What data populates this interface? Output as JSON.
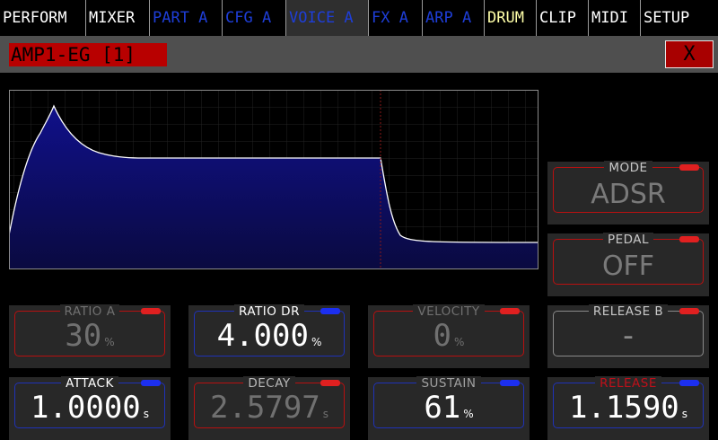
{
  "tabs": [
    {
      "label": "PERFORM",
      "color": "#ffffff"
    },
    {
      "label": "MIXER",
      "color": "#ffffff"
    },
    {
      "label": "PART A",
      "color": "#1e3ed8"
    },
    {
      "label": "CFG A",
      "color": "#1e3ed8"
    },
    {
      "label": "VOICE A",
      "color": "#1e3ed8",
      "active": true
    },
    {
      "label": "FX A",
      "color": "#1e3ed8"
    },
    {
      "label": "ARP A",
      "color": "#1e3ed8"
    },
    {
      "label": "DRUM",
      "color": "#ffffa8"
    },
    {
      "label": "CLIP",
      "color": "#ffffff"
    },
    {
      "label": "MIDI",
      "color": "#ffffff"
    },
    {
      "label": "SETUP",
      "color": "#ffffff"
    }
  ],
  "header": {
    "title": "AMP1-EG [1]",
    "close_label": "X"
  },
  "colors": {
    "envelope_fill_top": "#10108a",
    "envelope_fill_bottom": "#0a0a40",
    "accent_red": "#e02020",
    "accent_blue": "#1c2ff0"
  },
  "mode": {
    "label": "MODE",
    "value": "ADSR"
  },
  "pedal": {
    "label": "PEDAL",
    "value": "OFF"
  },
  "params": {
    "ratio_a": {
      "label": "RATIO A",
      "value": "30",
      "unit": "%"
    },
    "ratio_dr": {
      "label": "RATIO DR",
      "value": "4.000",
      "unit": "%"
    },
    "velocity": {
      "label": "VELOCITY",
      "value": "0",
      "unit": "%"
    },
    "release_b": {
      "label": "RELEASE B",
      "value": "-"
    },
    "attack": {
      "label": "ATTACK",
      "value": "1.0000",
      "unit": "s"
    },
    "decay": {
      "label": "DECAY",
      "value": "2.5797",
      "unit": "s"
    },
    "sustain": {
      "label": "SUSTAIN",
      "value": "61",
      "unit": "%"
    },
    "release": {
      "label": "RELEASE",
      "value": "1.1590",
      "unit": "s"
    }
  }
}
